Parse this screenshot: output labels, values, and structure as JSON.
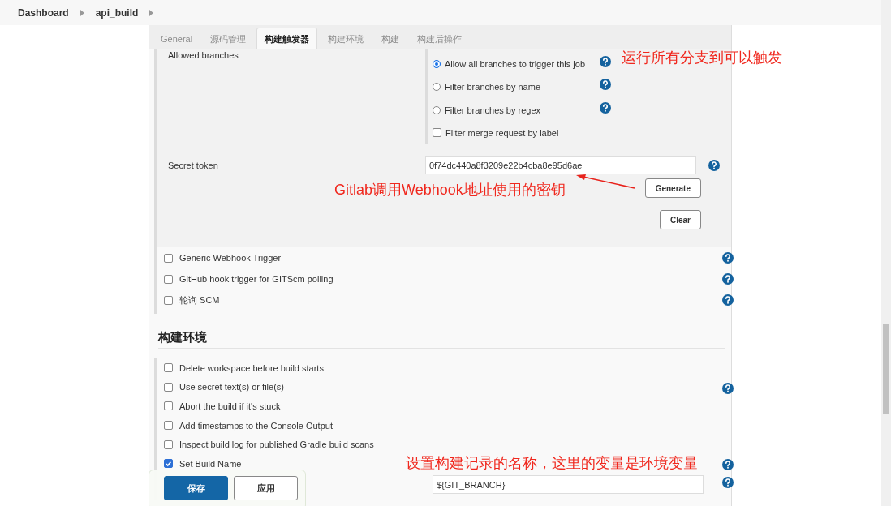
{
  "breadcrumbs": [
    {
      "label": "Dashboard"
    },
    {
      "label": "api_build"
    }
  ],
  "tabs": [
    {
      "label": "General",
      "selected": false
    },
    {
      "label": "源码管理",
      "selected": false
    },
    {
      "label": "构建触发器",
      "selected": true
    },
    {
      "label": "构建环境",
      "selected": false
    },
    {
      "label": "构建",
      "selected": false
    },
    {
      "label": "构建后操作",
      "selected": false
    }
  ],
  "allowed_branches": {
    "label": "Allowed branches",
    "options": [
      {
        "kind": "radio",
        "label": "Allow all branches to trigger this job",
        "selected": true,
        "help": true
      },
      {
        "kind": "radio",
        "label": "Filter branches by name",
        "selected": false,
        "help": true
      },
      {
        "kind": "radio",
        "label": "Filter branches by regex",
        "selected": false,
        "help": true
      },
      {
        "kind": "checkbox",
        "label": "Filter merge request by label",
        "checked": false,
        "help": false
      }
    ]
  },
  "secret_token": {
    "label": "Secret token",
    "value": "0f74dc440a8f3209e22b4cba8e95d6ae",
    "help": true,
    "buttons": [
      "Generate",
      "Clear"
    ]
  },
  "triggers": [
    {
      "label": "Generic Webhook Trigger",
      "checked": false,
      "help": true
    },
    {
      "label": "GitHub hook trigger for GITScm polling",
      "checked": false,
      "help": true
    },
    {
      "label": "轮询 SCM",
      "checked": false,
      "help": true
    }
  ],
  "build_environment": {
    "heading": "构建环境",
    "options": [
      {
        "label": "Delete workspace before build starts",
        "checked": false,
        "help": false
      },
      {
        "label": "Use secret text(s) or file(s)",
        "checked": false,
        "help": true
      },
      {
        "label": "Abort the build if it's stuck",
        "checked": false,
        "help": false
      },
      {
        "label": "Add timestamps to the Console Output",
        "checked": false,
        "help": false
      },
      {
        "label": "Inspect build log for published Gradle build scans",
        "checked": false,
        "help": false
      },
      {
        "label": "Set Build Name",
        "checked": true,
        "help": true
      }
    ],
    "build_name_field": {
      "value": "${GIT_BRANCH}",
      "help": true
    }
  },
  "save_bar": {
    "buttons": [
      {
        "label": "保存",
        "kind": "primary"
      },
      {
        "label": "应用",
        "kind": "secondary"
      }
    ]
  },
  "annotations": [
    {
      "text": "运行所有分支到可以触发",
      "arrow": false
    },
    {
      "text": "Gitlab调用Webhook地址使用的密钥",
      "arrow": true
    },
    {
      "text": "设置构建记录的名称，这里的变量是环境变量",
      "arrow": false
    }
  ]
}
